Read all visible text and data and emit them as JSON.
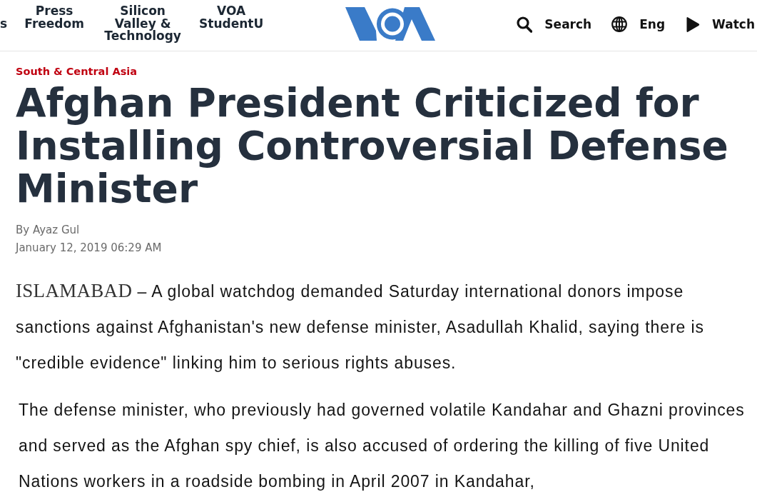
{
  "header": {
    "nav_items": [
      "s",
      "Press Freedom",
      "Silicon Valley & Technology",
      "VOA StudentU"
    ],
    "actions": [
      {
        "kind": "search",
        "label": "Search"
      },
      {
        "kind": "language",
        "label": "Eng"
      },
      {
        "kind": "watch",
        "label": "Watch"
      }
    ]
  },
  "article": {
    "category": "South & Central Asia",
    "headline": "Afghan President Criticized for Installing Controversial Defense Minister",
    "byline": "By Ayaz Gul",
    "date": "January 12, 2019 06:29 AM",
    "paragraphs": [
      {
        "dateline": "ISLAMABAD",
        "text": "– A global watchdog demanded Saturday international donors impose sanctions against Afghanistan's new defense minister, Asadullah Khalid, saying there is \"credible evidence\" linking him to serious rights abuses."
      },
      {
        "text": "The defense minister, who previously had governed volatile Kandahar and Ghazni provinces and served as the Afghan spy chief, is also accused of ordering the killing of five United Nations workers in a roadside bombing in April 2007 in Kandahar,"
      }
    ]
  }
}
